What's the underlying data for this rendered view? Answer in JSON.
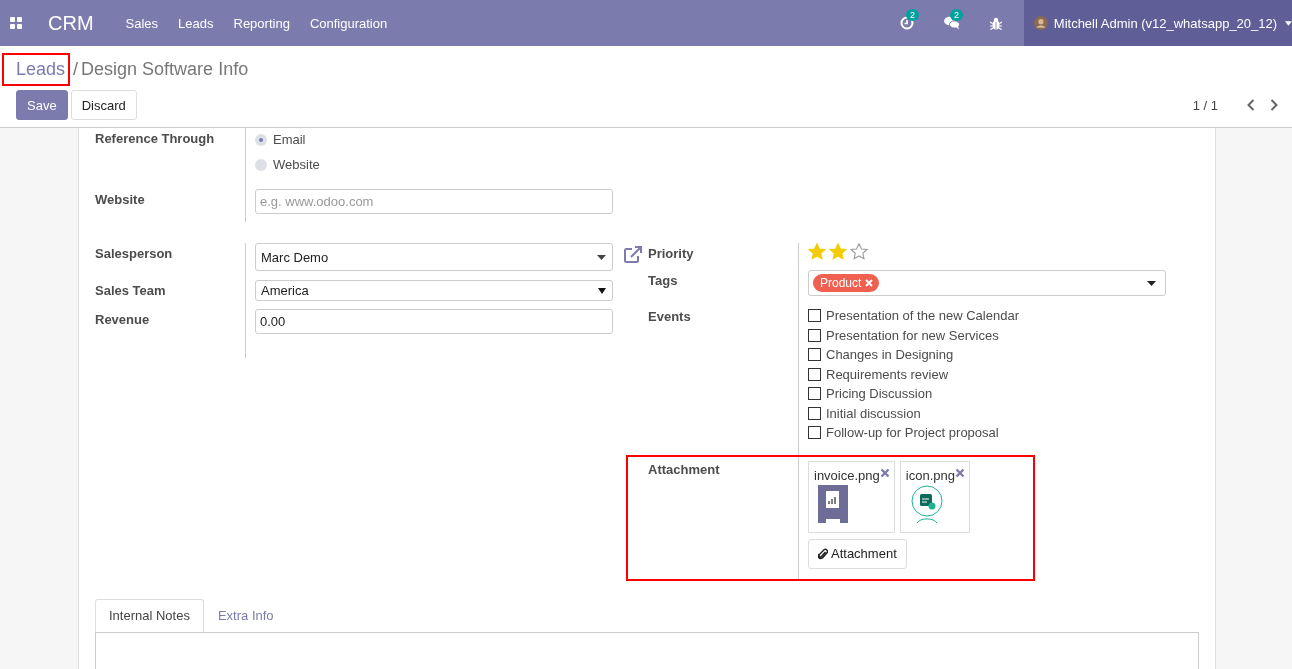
{
  "navbar": {
    "app_title": "CRM",
    "menu": [
      "Sales",
      "Leads",
      "Reporting",
      "Configuration"
    ],
    "activity_count": "2",
    "message_count": "2",
    "user": "Mitchell Admin (v12_whatsapp_20_12)"
  },
  "breadcrumb": {
    "parent": "Leads",
    "separator": "/",
    "current": "Design Software Info",
    "parent_highlighted": true
  },
  "buttons": {
    "save": "Save",
    "discard": "Discard"
  },
  "pager": "1 / 1",
  "form": {
    "reference_through": {
      "label": "Reference Through",
      "options": [
        {
          "label": "Email",
          "selected": true
        },
        {
          "label": "Website",
          "selected": false
        }
      ]
    },
    "website": {
      "label": "Website",
      "placeholder": "e.g. www.odoo.com"
    },
    "salesperson": {
      "label": "Salesperson",
      "value": "Marc Demo"
    },
    "sales_team": {
      "label": "Sales Team",
      "value": "America"
    },
    "revenue": {
      "label": "Revenue",
      "value": "0.00"
    },
    "priority": {
      "label": "Priority",
      "stars": 2
    },
    "tags": {
      "label": "Tags",
      "items": [
        {
          "label": "Product",
          "color": "#f06050"
        }
      ]
    },
    "events": {
      "label": "Events",
      "options": [
        {
          "label": "Presentation of the new Calendar",
          "checked": false
        },
        {
          "label": "Presentation for new Services",
          "checked": false
        },
        {
          "label": "Changes in Designing",
          "checked": false
        },
        {
          "label": "Requirements review",
          "checked": false
        },
        {
          "label": "Pricing Discussion",
          "checked": false
        },
        {
          "label": "Initial discussion",
          "checked": false
        },
        {
          "label": "Follow-up for Project proposal",
          "checked": false
        }
      ]
    },
    "attachment": {
      "label": "Attachment",
      "highlighted": true,
      "files": [
        {
          "name": "invoice.png",
          "kind": "invoice"
        },
        {
          "name": "icon.png",
          "kind": "calendar"
        }
      ],
      "button": "Attachment"
    }
  },
  "tabs": [
    {
      "label": "Internal Notes",
      "selected": true
    },
    {
      "label": "Extra Info",
      "selected": false
    }
  ]
}
